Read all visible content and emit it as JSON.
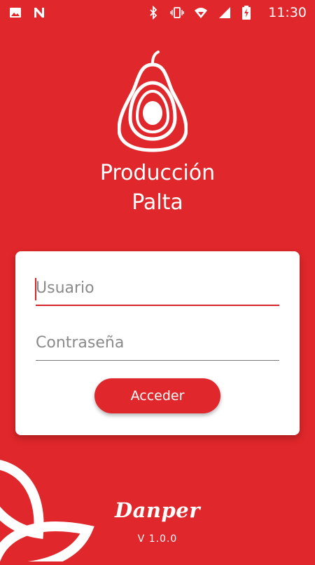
{
  "status_bar": {
    "time": "11:30",
    "left_icons": [
      "image-icon",
      "n-notification-icon"
    ],
    "right_icons": [
      "bluetooth-icon",
      "vibrate-icon",
      "wifi-icon",
      "signal-icon",
      "battery-charging-icon"
    ]
  },
  "app": {
    "title_line1": "Producción",
    "title_line2": "Palta",
    "logo_icon": "avocado-icon"
  },
  "login": {
    "username_placeholder": "Usuario",
    "username_value": "",
    "password_placeholder": "Contraseña",
    "password_value": "",
    "submit_label": "Acceder"
  },
  "footer": {
    "brand": "Danper",
    "version": "V 1.0.0"
  },
  "colors": {
    "primary": "#E0272B",
    "card": "#FFFFFF",
    "accent_line": "#D82328"
  }
}
